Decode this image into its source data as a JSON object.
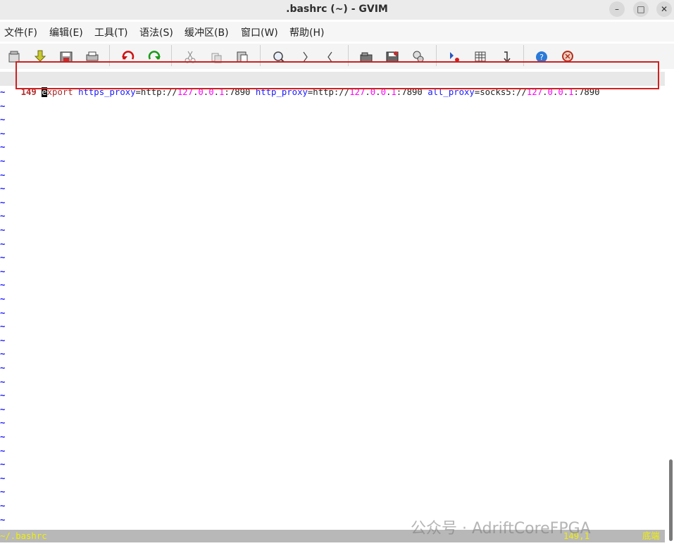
{
  "window": {
    "title": ".bashrc (~) - GVIM",
    "buttons": {
      "minimize": "–",
      "maximize": "□",
      "close": "✕"
    }
  },
  "menu": {
    "items": [
      "文件(F)",
      "编辑(E)",
      "工具(T)",
      "语法(S)",
      "缓冲区(B)",
      "窗口(W)",
      "帮助(H)"
    ]
  },
  "toolbar": {
    "icons": [
      "open-icon",
      "save-down-icon",
      "save-icon",
      "print-icon",
      "undo-icon",
      "redo-icon",
      "cut-icon",
      "copy-icon",
      "paste-icon",
      "find-replace-icon",
      "find-next-icon",
      "find-prev-icon",
      "load-session-icon",
      "save-session-icon",
      "run-script-icon",
      "make-icon",
      "shell-icon",
      "tags-icon",
      "help-icon",
      "find-help-icon"
    ]
  },
  "editor": {
    "line_number": "149",
    "cursor_char": "e",
    "tokens": [
      {
        "t": "xport",
        "c": "kw"
      },
      {
        "t": " ",
        "c": "txt"
      },
      {
        "t": "https_proxy",
        "c": "var"
      },
      {
        "t": "=http://",
        "c": "txt"
      },
      {
        "t": "127",
        "c": "num"
      },
      {
        "t": ".",
        "c": "txt"
      },
      {
        "t": "0",
        "c": "num"
      },
      {
        "t": ".",
        "c": "txt"
      },
      {
        "t": "0",
        "c": "num"
      },
      {
        "t": ".",
        "c": "txt"
      },
      {
        "t": "1",
        "c": "num"
      },
      {
        "t": ":7890 ",
        "c": "txt"
      },
      {
        "t": "http_proxy",
        "c": "var"
      },
      {
        "t": "=http://",
        "c": "txt"
      },
      {
        "t": "127",
        "c": "num"
      },
      {
        "t": ".",
        "c": "txt"
      },
      {
        "t": "0",
        "c": "num"
      },
      {
        "t": ".",
        "c": "txt"
      },
      {
        "t": "0",
        "c": "num"
      },
      {
        "t": ".",
        "c": "txt"
      },
      {
        "t": "1",
        "c": "num"
      },
      {
        "t": ":7890 ",
        "c": "txt"
      },
      {
        "t": "all_proxy",
        "c": "var"
      },
      {
        "t": "=socks5://",
        "c": "txt"
      },
      {
        "t": "127",
        "c": "num"
      },
      {
        "t": ".",
        "c": "txt"
      },
      {
        "t": "0",
        "c": "num"
      },
      {
        "t": ".",
        "c": "txt"
      },
      {
        "t": "0",
        "c": "num"
      },
      {
        "t": ".",
        "c": "txt"
      },
      {
        "t": "1",
        "c": "num"
      },
      {
        "t": ":7890",
        "c": "txt"
      }
    ],
    "empty_marker": "~",
    "empty_line_count": 32
  },
  "status": {
    "filename": "~/.bashrc",
    "position": "149,1",
    "scroll": "底端"
  },
  "watermark": "公众号 · AdriftCoreFPGA",
  "colors": {
    "keyword": "#a52a2a",
    "identifier": "#1a1aff",
    "number": "#ff00ff",
    "highlight_box": "#d02020",
    "status_text": "#f0f000"
  }
}
